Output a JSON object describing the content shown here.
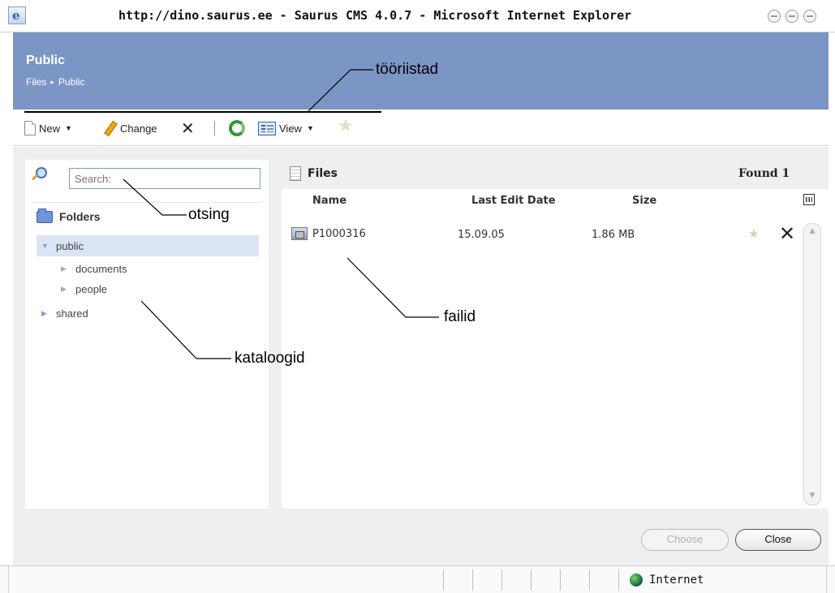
{
  "window": {
    "title": "http://dino.saurus.ee - Saurus CMS 4.0.7 - Microsoft Internet Explorer",
    "icon": "ie-icon"
  },
  "header": {
    "title": "Public",
    "breadcrumb": [
      "Files",
      "Public"
    ]
  },
  "toolbar": {
    "new_label": "New",
    "change_label": "Change",
    "view_label": "View"
  },
  "left": {
    "search_placeholder": "Search:",
    "folders_label": "Folders",
    "tree": [
      {
        "label": "public",
        "expanded": true,
        "selected": true
      },
      {
        "label": "documents",
        "child": true
      },
      {
        "label": "people",
        "child": true
      },
      {
        "label": "shared",
        "expanded": false
      }
    ]
  },
  "files": {
    "title": "Files",
    "found": "Found 1",
    "columns": {
      "name": "Name",
      "date": "Last Edit Date",
      "size": "Size"
    },
    "rows": [
      {
        "name": "P1000316",
        "date": "15.09.05",
        "size": "1.86 MB"
      }
    ]
  },
  "buttons": {
    "choose": "Choose",
    "close": "Close"
  },
  "status": {
    "zone": "Internet"
  },
  "annotations": {
    "tools": "tööriistad",
    "search": "otsing",
    "files": "failid",
    "folders": "kataloogid"
  }
}
